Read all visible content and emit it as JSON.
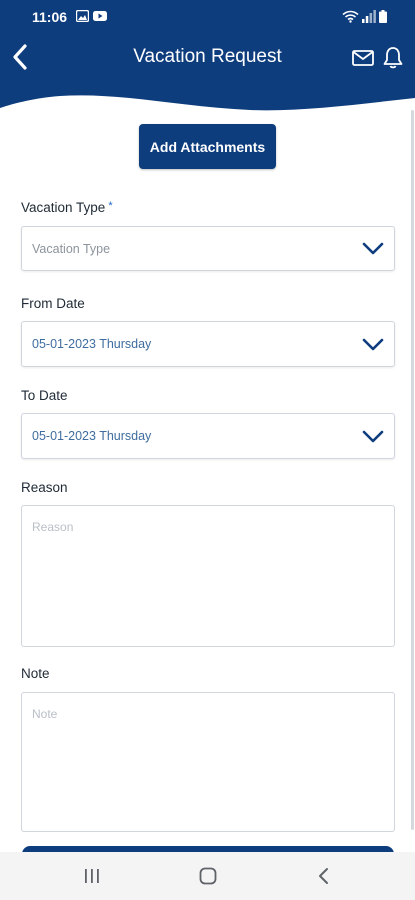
{
  "status_bar": {
    "time": "11:06",
    "left_icons": [
      "image-icon",
      "youtube-icon"
    ],
    "right_icons": [
      "wifi-icon",
      "signal-icon",
      "battery-icon"
    ]
  },
  "header": {
    "title": "Vacation Request",
    "back_icon": "chevron-left-icon",
    "mail_icon": "mail-icon",
    "bell_icon": "bell-icon",
    "bg_color": "#0e3d7e"
  },
  "attachments_button": {
    "label": "Add Attachments"
  },
  "form": {
    "vacation_type": {
      "label": "Vacation Type",
      "required_mark": "*",
      "placeholder": "Vacation Type"
    },
    "from_date": {
      "label": "From Date",
      "value": "05-01-2023 Thursday"
    },
    "to_date": {
      "label": "To Date",
      "value": "05-01-2023 Thursday"
    },
    "reason": {
      "label": "Reason",
      "placeholder": "Reason"
    },
    "note": {
      "label": "Note",
      "placeholder": "Note"
    }
  },
  "nav_bar": {
    "items": [
      "recent-apps-icon",
      "home-icon",
      "back-icon"
    ]
  }
}
